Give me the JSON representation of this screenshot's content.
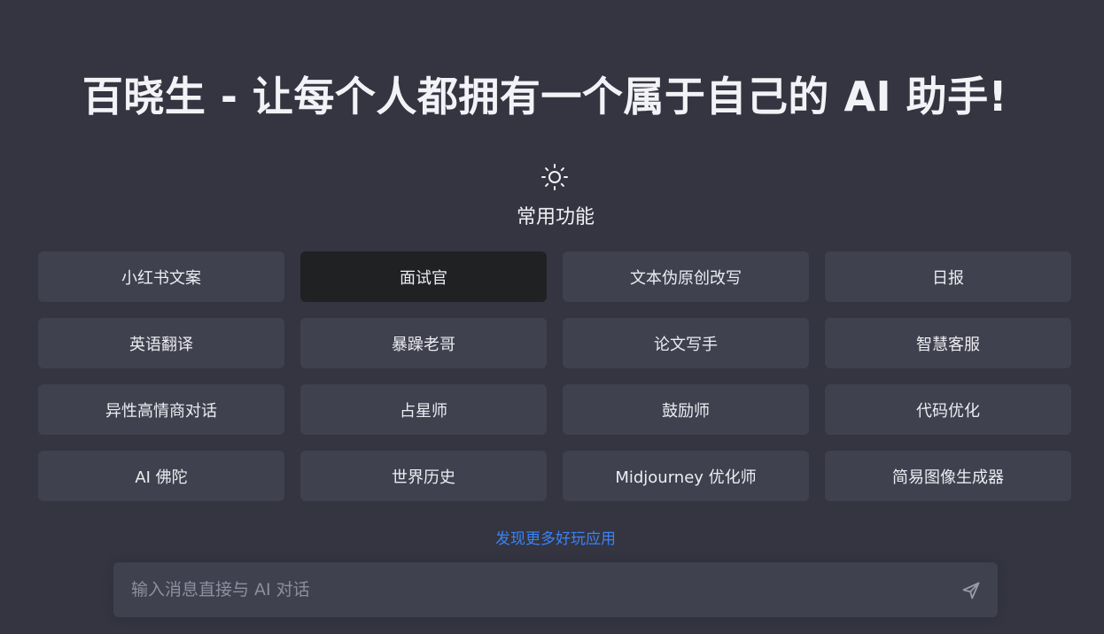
{
  "header": {
    "title": "百晓生 - 让每个人都拥有一个属于自己的 AI 助手!"
  },
  "section": {
    "icon": "sun-icon",
    "title": "常用功能"
  },
  "functions": [
    {
      "label": "小红书文案",
      "active": false
    },
    {
      "label": "面试官",
      "active": true
    },
    {
      "label": "文本伪原创改写",
      "active": false
    },
    {
      "label": "日报",
      "active": false
    },
    {
      "label": "英语翻译",
      "active": false
    },
    {
      "label": "暴躁老哥",
      "active": false
    },
    {
      "label": "论文写手",
      "active": false
    },
    {
      "label": "智慧客服",
      "active": false
    },
    {
      "label": "异性高情商对话",
      "active": false
    },
    {
      "label": "占星师",
      "active": false
    },
    {
      "label": "鼓励师",
      "active": false
    },
    {
      "label": "代码优化",
      "active": false
    },
    {
      "label": "AI 佛陀",
      "active": false
    },
    {
      "label": "世界历史",
      "active": false
    },
    {
      "label": "Midjourney 优化师",
      "active": false
    },
    {
      "label": "简易图像生成器",
      "active": false
    }
  ],
  "discover": {
    "label": "发现更多好玩应用"
  },
  "chat": {
    "placeholder": "输入消息直接与 AI 对话",
    "value": "",
    "send_icon": "send-icon"
  },
  "colors": {
    "background": "#343541",
    "card": "#40414f",
    "card_active": "#202123",
    "link": "#3b82f6"
  }
}
